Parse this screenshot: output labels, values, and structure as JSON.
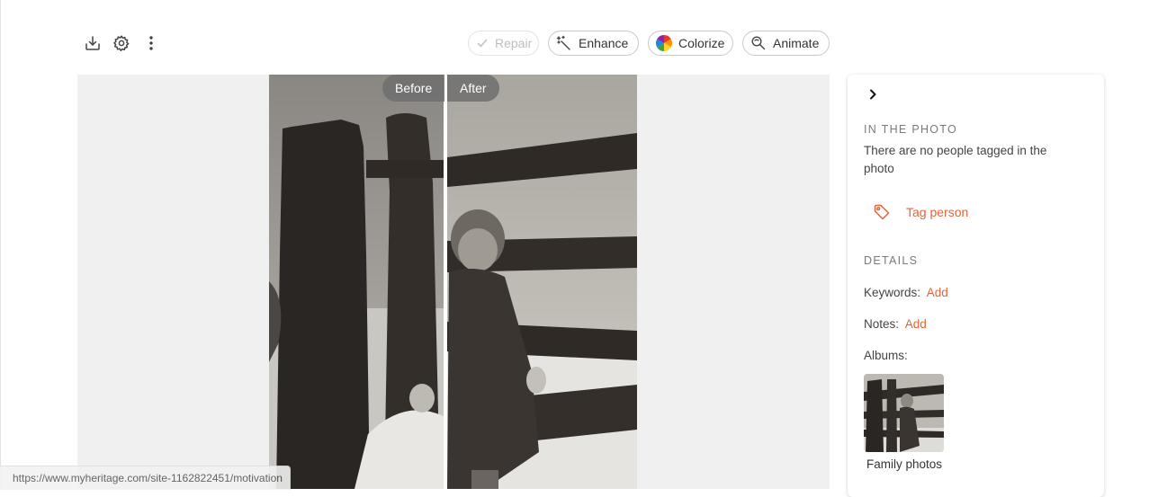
{
  "toolbar": {
    "repair_label": "Repair",
    "enhance_label": "Enhance",
    "colorize_label": "Colorize",
    "animate_label": "Animate"
  },
  "viewer": {
    "before_label": "Before",
    "after_label": "After"
  },
  "panel": {
    "in_photo_title": "IN THE PHOTO",
    "no_people_text": "There are no people tagged in the photo",
    "tag_person_label": "Tag person",
    "details_title": "DETAILS",
    "keywords_label": "Keywords:",
    "keywords_add": "Add",
    "notes_label": "Notes:",
    "notes_add": "Add",
    "albums_label": "Albums:",
    "album_name": "Family photos"
  },
  "status_bar": {
    "url": "https://www.myheritage.com/site-1162822451/motivation"
  },
  "colors": {
    "accent": "#e0643b",
    "viewer_bg": "#f0f0f0"
  },
  "icons": [
    "download-icon",
    "settings-icon",
    "more-vertical-icon",
    "check-icon",
    "magic-wand-icon",
    "color-wheel-icon",
    "animate-search-icon",
    "chevron-right-icon",
    "tag-icon"
  ]
}
